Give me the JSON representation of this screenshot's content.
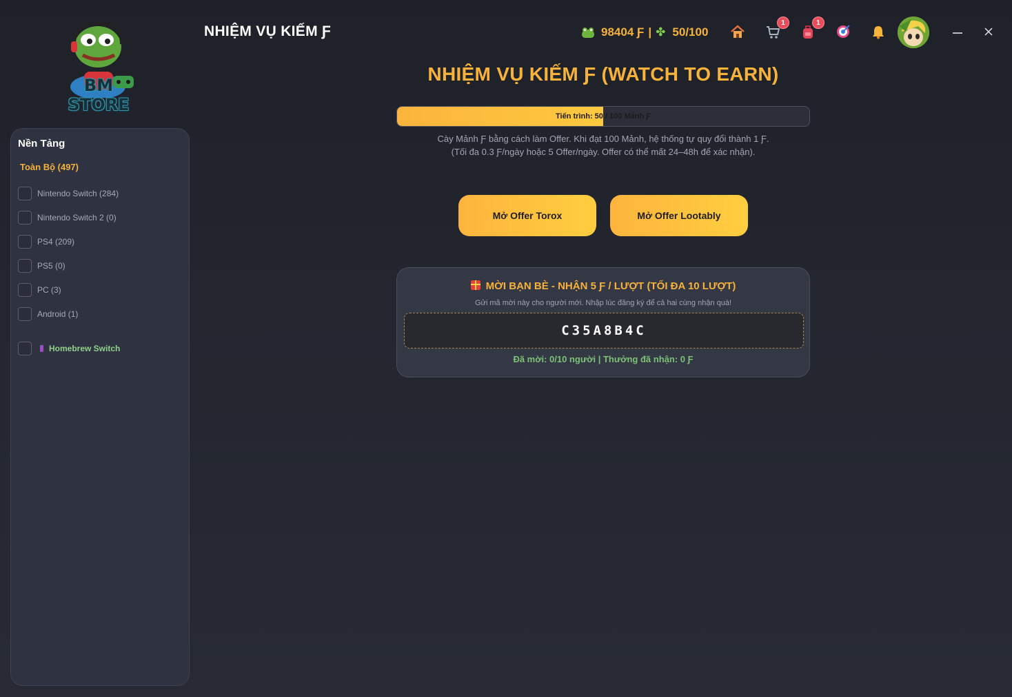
{
  "logo": {
    "text": "BM STORE"
  },
  "sidebar": {
    "title": "Nền Tảng",
    "all_label": "Toàn Bộ (497)",
    "platforms": [
      {
        "label": "Nintendo Switch (284)"
      },
      {
        "label": "Nintendo Switch 2 (0)"
      },
      {
        "label": "PS4 (209)"
      },
      {
        "label": "PS5 (0)"
      },
      {
        "label": "PC (3)"
      },
      {
        "label": "Android (1)"
      }
    ],
    "homebrew_label": "Homebrew Switch"
  },
  "header": {
    "title": "NHIỆM VỤ KIẾM Ƒ",
    "coins": "98404 Ƒ",
    "separator": "|",
    "pieces": "50/100",
    "icons": [
      {
        "name": "home-icon"
      },
      {
        "name": "cart-icon",
        "badge": "1"
      },
      {
        "name": "backpack-icon",
        "badge": "1"
      },
      {
        "name": "target-icon"
      },
      {
        "name": "bell-icon"
      }
    ]
  },
  "main": {
    "title": "NHIỆM VỤ KIẾM Ƒ (WATCH TO EARN)",
    "progress": {
      "label": "Tiến trình: 50 / 100 Mảnh Ƒ",
      "value": 50,
      "max": 100
    },
    "desc_line1": "Cày Mảnh Ƒ bằng cách làm Offer. Khi đạt 100 Mảnh, hệ thống tự quy đổi thành 1 Ƒ.",
    "desc_line2": "(Tối đa 0.3 Ƒ/ngày hoặc 5 Offer/ngày. Offer có thể mất 24–48h để xác nhận).",
    "btn_torox": "Mở Offer Torox",
    "btn_lootably": "Mở Offer Lootably"
  },
  "invite": {
    "title": "MỜI BẠN BÈ - NHẬN 5 Ƒ / LƯỢT (TỐI ĐA 10 LƯỢT)",
    "subtitle": "Gửi mã mời này cho người mới. Nhập lúc đăng ký để cả hai cùng nhận quà!",
    "code": "C35A8B4C",
    "stats": "Đã mời: 0/10 người | Thưởng đã nhận: 0 Ƒ"
  },
  "colors": {
    "accent": "#f7b23b",
    "success": "#7cc277",
    "badge": "#e84d5b"
  }
}
